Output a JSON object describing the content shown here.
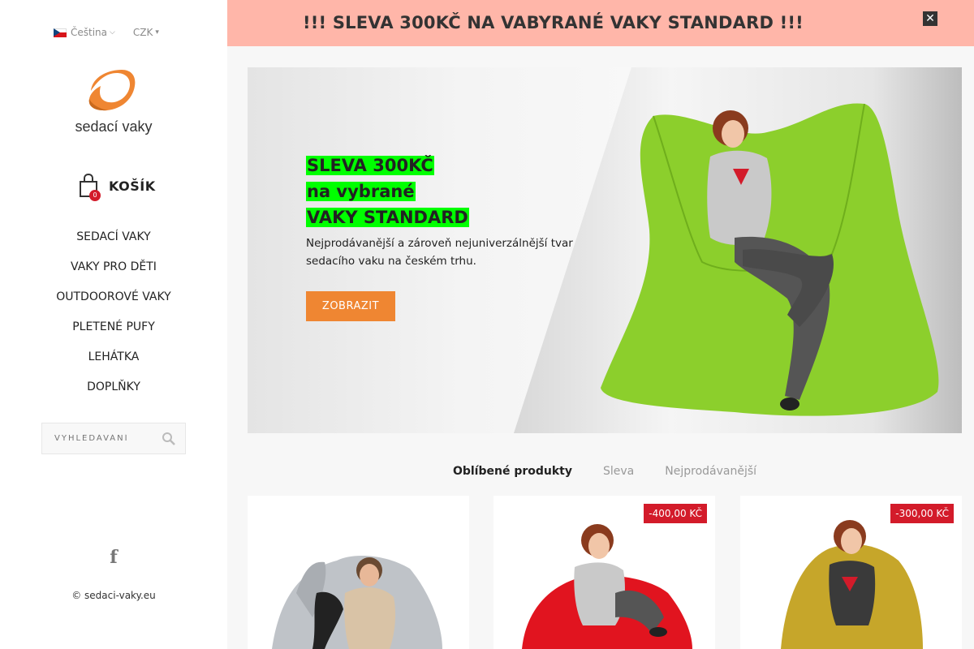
{
  "sidebar": {
    "language": "Čeština",
    "currency": "CZK",
    "logo_text": "sedací vaky",
    "cart": {
      "count": "0",
      "label": "KOŠÍK"
    },
    "nav": [
      "SEDACÍ VAKY",
      "VAKY PRO DĚTI",
      "OUTDOOROVÉ VAKY",
      "PLETENÉ PUFY",
      "LEHÁTKA",
      "DOPLŇKY"
    ],
    "search_placeholder": "VYHLEDÁVÁNÍ",
    "copyright": "© sedaci-vaky.eu"
  },
  "promo": {
    "text": "!!! SLEVA 300KČ NA VABYRANÉ VAKY STANDARD !!!",
    "close": "✕"
  },
  "hero": {
    "title_lines": [
      "SLEVA 300KČ",
      "na vybrané",
      "VAKY STANDARD"
    ],
    "description": "Nejprodávanější a zároveň nejuniverzálnější tvar sedacího vaku na českém trhu.",
    "button": "ZOBRAZIT"
  },
  "tabs": [
    "Oblíbené produkty",
    "Sleva",
    "Nejprodávanější"
  ],
  "products": [
    {
      "badge": ""
    },
    {
      "badge": "-400,00 KČ"
    },
    {
      "badge": "-300,00 KČ"
    }
  ],
  "colors": {
    "accent": "#ef8632",
    "promo_bg": "#ffb6a9",
    "highlight": "#00ff00",
    "badge": "#d31b2a"
  }
}
